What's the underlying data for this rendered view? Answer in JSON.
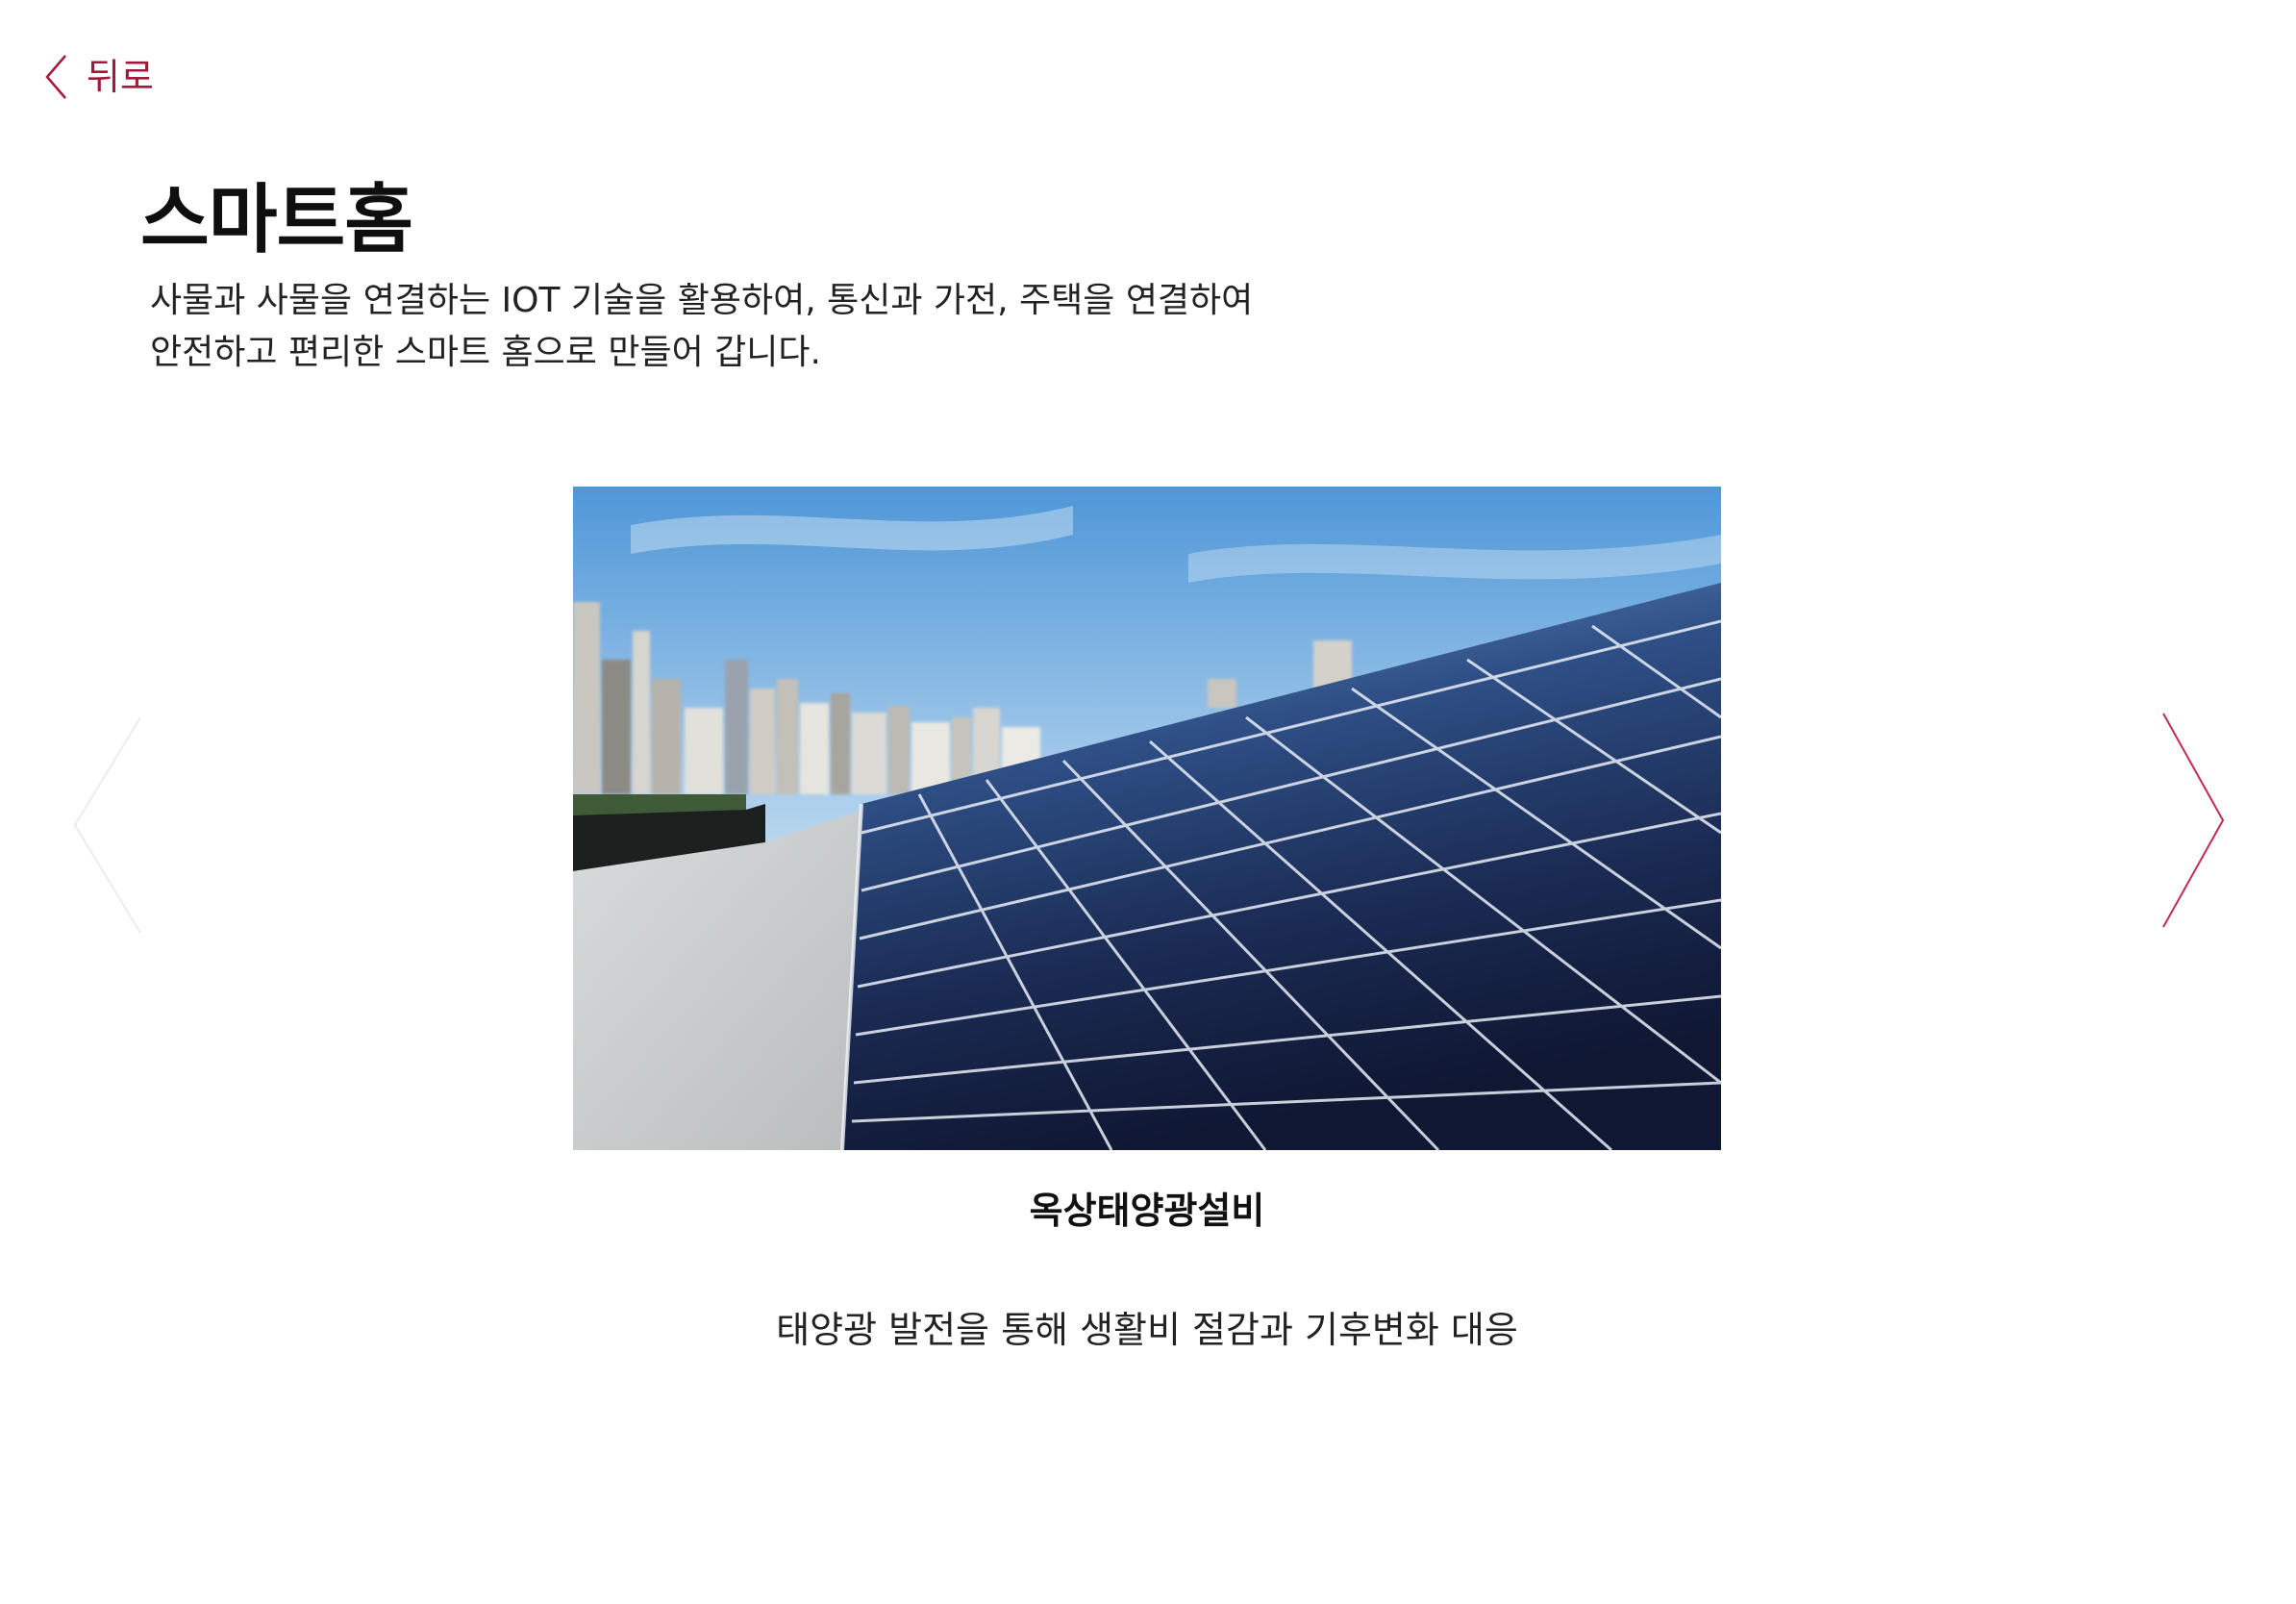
{
  "back": {
    "label": "뒤로",
    "icon": "chevron-left-icon"
  },
  "header": {
    "title": "스마트홈",
    "description_lines": [
      "사물과 사물을 연결하는 IOT 기술을 활용하여, 통신과 가전, 주택을 연결하여",
      "안전하고 편리한 스마트 홈으로 만들어 갑니다."
    ]
  },
  "carousel": {
    "prev_icon": "chevron-left-large-icon",
    "next_icon": "chevron-right-large-icon",
    "slide": {
      "image": "rooftop-solar-panels-photo",
      "title": "옥상태양광설비",
      "description": "태양광 발전을 통해 생활비 절감과 기후변화 대응"
    }
  },
  "colors": {
    "accent": "#a5173b",
    "text": "#111111",
    "background": "#ffffff"
  }
}
